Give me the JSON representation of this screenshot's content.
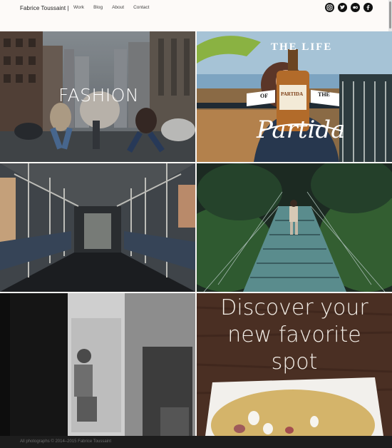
{
  "header": {
    "brand": "Fabrice Toussaint |",
    "nav": [
      "Work",
      "Blog",
      "About",
      "Contact"
    ],
    "social": [
      "instagram-icon",
      "twitter-icon",
      "flickr-icon",
      "facebook-icon"
    ]
  },
  "tiles": {
    "fashion": {
      "title": "FASHION"
    },
    "partida": {
      "arc_top": "THE LIFE",
      "left": "OF",
      "right": "THE",
      "bottle": "PARTIDA",
      "script": "Partida"
    },
    "discover": {
      "line1": "Discover your",
      "line2": "new favorite",
      "line3": "spot"
    }
  },
  "footer": {
    "text": "All photographs © 2014–2015 Fabrice Toussaint"
  },
  "colors": {
    "header_bg": "#fdfaf8",
    "footer_bg": "#1d1d1d",
    "overlay_text": "#ffffff"
  }
}
